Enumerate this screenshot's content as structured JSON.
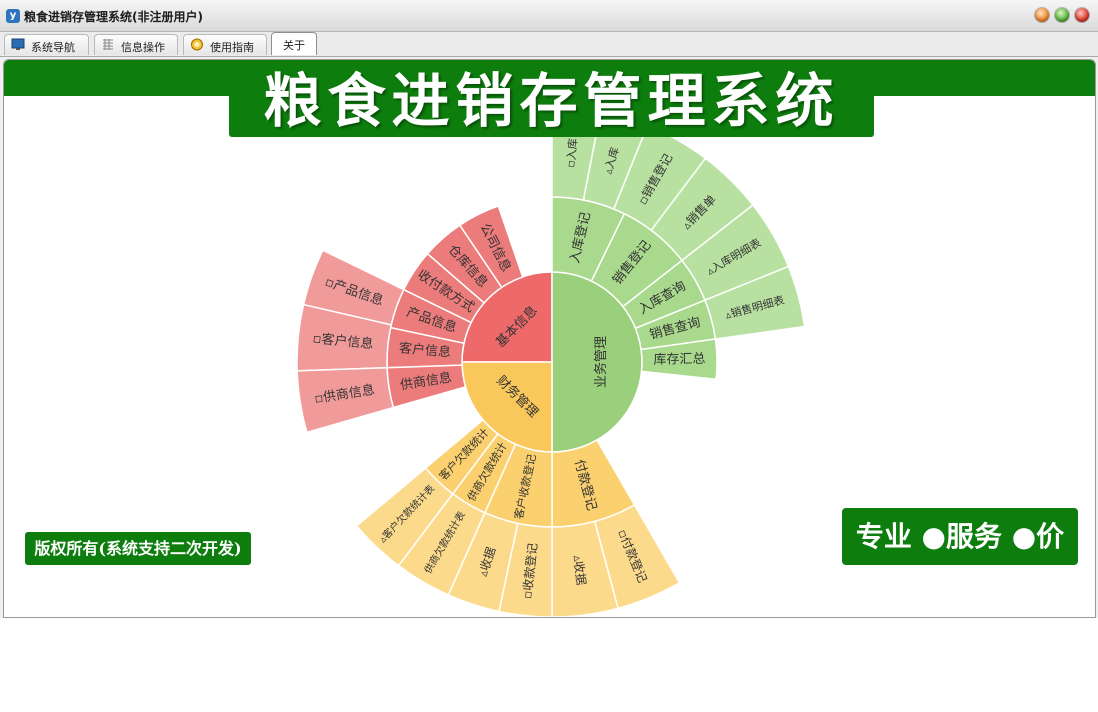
{
  "window": {
    "title": "粮食进销存管理系统(非注册用户)"
  },
  "tabs": [
    {
      "label": "系统导航",
      "icon": "monitor-icon"
    },
    {
      "label": "信息操作",
      "icon": "grid-icon"
    },
    {
      "label": "使用指南",
      "icon": "guide-icon"
    },
    {
      "label": "关于",
      "icon": ""
    }
  ],
  "banner": {
    "title": "粮食进销存管理系统"
  },
  "footer": {
    "copyright": "版权所有(系统支持二次开发)",
    "slogan": "专业 ●服务 ●价值"
  },
  "colors": {
    "brand_green": "#0d7d0d",
    "basic_info": "#ee6a6a",
    "business": "#9ad07b",
    "finance": "#f9c75a"
  },
  "sunburst": {
    "center_groups": [
      {
        "label": "基本信息"
      },
      {
        "label": "业务管理"
      },
      {
        "label": "财务管理"
      }
    ],
    "level2": [
      {
        "label": "公司信息"
      },
      {
        "label": "仓库信息"
      },
      {
        "label": "收付款方式"
      },
      {
        "label": "产品信息"
      },
      {
        "label": "客户信息"
      },
      {
        "label": "供商信息"
      },
      {
        "label": "入库登记"
      },
      {
        "label": "销售登记"
      },
      {
        "label": "入库查询"
      },
      {
        "label": "销售查询"
      },
      {
        "label": "库存汇总"
      },
      {
        "label": "付款登记"
      },
      {
        "label": "客户收款登记"
      },
      {
        "label": "供商欠款统计"
      },
      {
        "label": "客户欠款统计"
      }
    ],
    "level3": [
      {
        "label": "▫产品信息"
      },
      {
        "label": "▫客户信息"
      },
      {
        "label": "▫供商信息"
      },
      {
        "label": "▫入库"
      },
      {
        "label": "▵入库"
      },
      {
        "label": "▫销售登记"
      },
      {
        "label": "▵销售单"
      },
      {
        "label": "▵入库明细表"
      },
      {
        "label": "▵销售明细表"
      },
      {
        "label": "▫付款登记"
      },
      {
        "label": "▵收据"
      },
      {
        "label": "▫收款登记"
      },
      {
        "label": "▵收据"
      },
      {
        "label": "供商欠款统计表"
      },
      {
        "label": "▵客户欠款统计表"
      }
    ]
  }
}
